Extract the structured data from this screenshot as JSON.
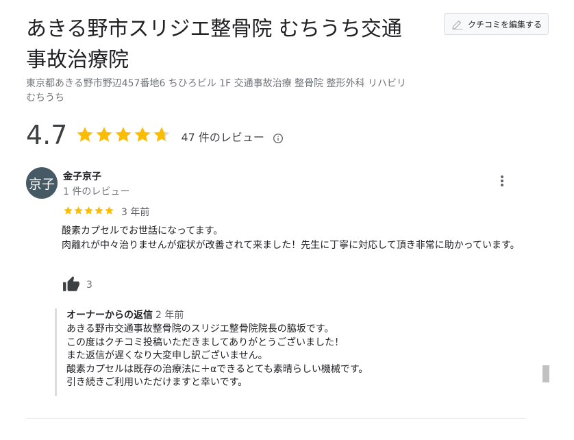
{
  "header": {
    "title": "あきる野市スリジエ整骨院 むちうち交通事故治療院",
    "address": "東京都あきる野市野辺457番地6 ちひろビル 1F 交通事故治療 整骨院 整形外科 リハビリ むちうち",
    "edit_button_label": "クチコミを編集する"
  },
  "summary": {
    "rating": "4.7",
    "rating_value": 4.7,
    "max_stars": 5,
    "review_count_text": "47 件のレビュー",
    "star_color": "#fbbc04",
    "empty_star_color": "#dadce0"
  },
  "review": {
    "avatar_text": "京子",
    "avatar_color": "#455a64",
    "reviewer_name": "金子京子",
    "reviewer_review_count": "1 件のレビュー",
    "stars": 5,
    "age": "3 年前",
    "text_lines": [
      "酸素カプセルでお世話になってます。",
      "肉離れが中々治りませんが症状が改善されて来ました！先生に丁寧に対応して頂き非常に助かっています。"
    ],
    "like_count": "3",
    "owner_reply": {
      "label": "オーナーからの返信",
      "age": "2 年前",
      "lines": [
        "あきる野市交通事故整骨院のスリジエ整骨院院長の脇坂です。",
        "この度はクチコミ投稿いただきましてありがとうございました！",
        "また返信が遅くなり大変申し訳ございません。",
        "酸素カプセルは既存の治療法に＋αできるとても素晴らしい機械です。",
        "引き続きご利用いただけますと幸いです。"
      ]
    }
  },
  "icons": {
    "edit": "pencil-icon",
    "info": "info-icon",
    "more": "more-vert-icon",
    "like": "thumbs-up-icon",
    "star": "star-icon"
  }
}
